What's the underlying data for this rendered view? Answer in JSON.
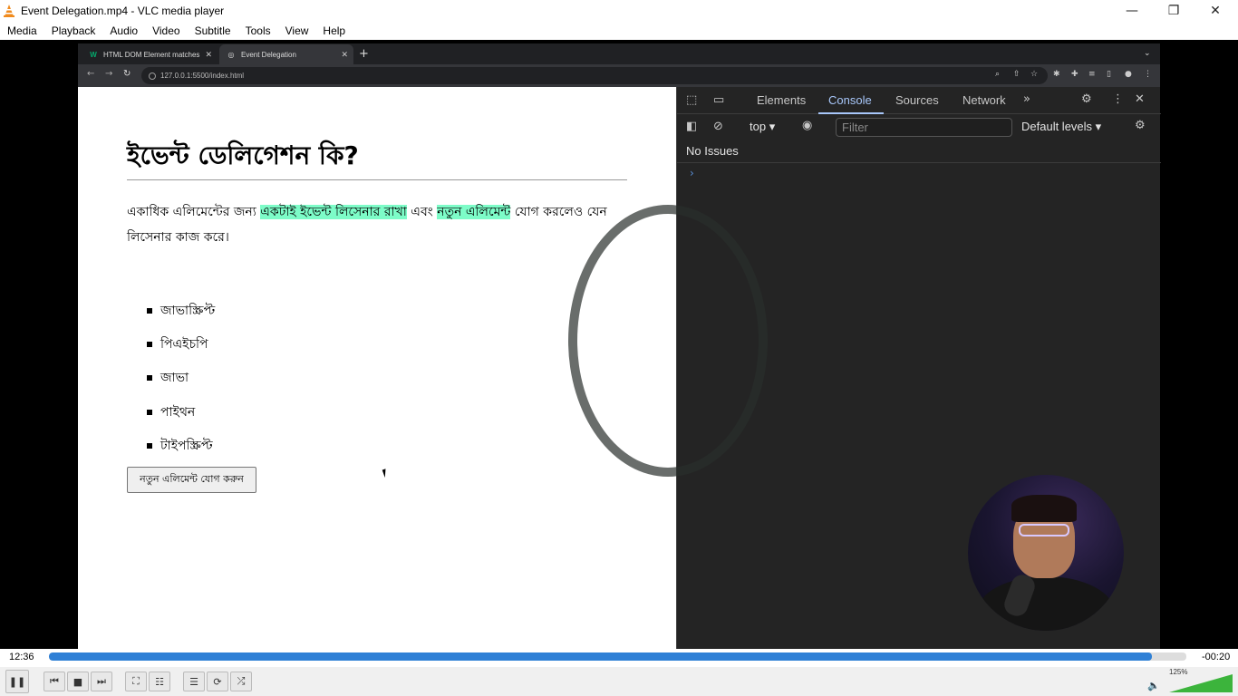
{
  "vlc": {
    "title": "Event Delegation.mp4 - VLC media player",
    "menus": [
      "Media",
      "Playback",
      "Audio",
      "Video",
      "Subtitle",
      "Tools",
      "View",
      "Help"
    ],
    "elapsed": "12:36",
    "remaining": "-00:20",
    "progress_fraction": 0.97,
    "volume": "125%"
  },
  "browser": {
    "tabs": [
      {
        "label": "HTML DOM Element matches",
        "favicon": "w3schools-icon"
      },
      {
        "label": "Event Delegation",
        "favicon": "globe-icon"
      }
    ],
    "url": "127.0.0.1:5500/index.html"
  },
  "page": {
    "heading": "ইভেন্ট ডেলিগেশন কি?",
    "para_part1": "একাধিক এলিমেন্টের জন্য ",
    "para_hl1": "একটাই ইভেন্ট লিসেনার রাখা",
    "para_part2": " এবং ",
    "para_hl2": "নতুন এলিমেন্ট",
    "para_part3": " যোগ করলেও যেন লিসেনার কাজ করে।",
    "highlight_color": "#7dfcc8",
    "items": [
      "জাভাস্ক্রিপ্ট",
      "পিএইচপি",
      "জাভা",
      "পাইথন",
      "টাইপস্ক্রিপ্ট"
    ],
    "add_button": "নতুন এলিমেন্ট যোগ করুন"
  },
  "devtools": {
    "tabs": [
      "Elements",
      "Console",
      "Sources",
      "Network"
    ],
    "active_tab": "Console",
    "context": "top",
    "filter_placeholder": "Filter",
    "levels": "Default levels",
    "issues": "No Issues"
  }
}
